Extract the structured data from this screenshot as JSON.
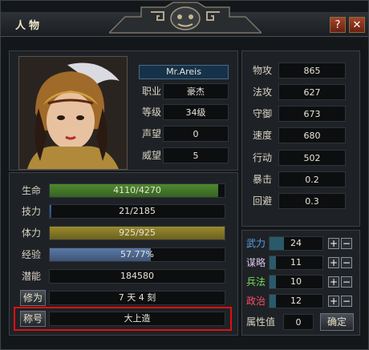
{
  "window": {
    "title": "人物",
    "help_label": "?",
    "close_label": "✕"
  },
  "character": {
    "name": "Mr.Areis",
    "rows": [
      {
        "label": "职业",
        "value": "豪杰"
      },
      {
        "label": "等级",
        "value": "34级"
      },
      {
        "label": "声望",
        "value": "0"
      },
      {
        "label": "威望",
        "value": "5"
      }
    ]
  },
  "attributes": [
    {
      "label": "物攻",
      "value": "865"
    },
    {
      "label": "法攻",
      "value": "627"
    },
    {
      "label": "守御",
      "value": "673"
    },
    {
      "label": "速度",
      "value": "680"
    },
    {
      "label": "行动",
      "value": "502"
    },
    {
      "label": "暴击",
      "value": "0.2"
    },
    {
      "label": "回避",
      "value": "0.3"
    }
  ],
  "vitals": [
    {
      "label": "生命",
      "text": "4110/4270",
      "fraction": 0.9625,
      "color": "#4e8a2e"
    },
    {
      "label": "技力",
      "text": "21/2185",
      "fraction": 0.0096,
      "color": "#3a64a8"
    },
    {
      "label": "体力",
      "text": "925/925",
      "fraction": 1.0,
      "color": "#9a8a2a"
    },
    {
      "label": "经验",
      "text": "57.77%",
      "fraction": 0.5777,
      "color": "#5a78a8"
    },
    {
      "label": "潜能",
      "text": "184580",
      "fraction": 0,
      "color": "#000000"
    }
  ],
  "cultivation": {
    "label": "修为",
    "value": "7 天 4 刻"
  },
  "honor": {
    "label": "称号",
    "value": "大上造"
  },
  "stats": [
    {
      "label": "武力",
      "value": "24",
      "label_color": "#5aa0e0"
    },
    {
      "label": "谋略",
      "value": "11",
      "label_color": "#d8c0e8"
    },
    {
      "label": "兵法",
      "value": "10",
      "label_color": "#7adc5a"
    },
    {
      "label": "政治",
      "value": "12",
      "label_color": "#ff4a6a"
    }
  ],
  "points": {
    "label": "属性值",
    "value": "0",
    "confirm_label": "确定"
  },
  "controls": {
    "plus": "+",
    "minus": "−"
  },
  "colors": {
    "highlight_border": "#e01010",
    "name_plate": "#16324a"
  }
}
